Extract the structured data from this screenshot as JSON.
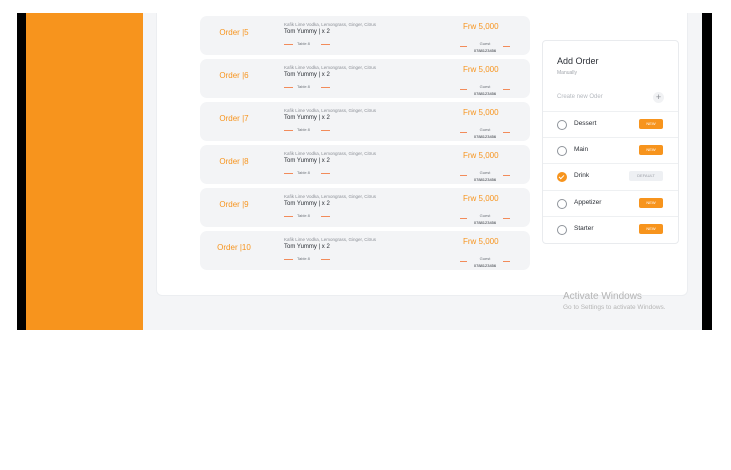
{
  "orders": [
    {
      "title": "Order |5",
      "desc": "Kafik Lime Vodka, Lemongrass, Ginger, Citrus",
      "item": "Tom Yummy  | x 2",
      "table": "Table 8",
      "price": "Frw 5,000",
      "guest": "Guest",
      "phone": "0788123456"
    },
    {
      "title": "Order |6",
      "desc": "Kafik Lime Vodka, Lemongrass, Ginger, Citrus",
      "item": "Tom Yummy  | x 2",
      "table": "Table 8",
      "price": "Frw 5,000",
      "guest": "Guest",
      "phone": "0788123456"
    },
    {
      "title": "Order |7",
      "desc": "Kafik Lime Vodka, Lemongrass, Ginger, Citrus",
      "item": "Tom Yummy  | x 2",
      "table": "Table 8",
      "price": "Frw 5,000",
      "guest": "Guest",
      "phone": "0788123456"
    },
    {
      "title": "Order |8",
      "desc": "Kafik Lime Vodka, Lemongrass, Ginger, Citrus",
      "item": "Tom Yummy  | x 2",
      "table": "Table 8",
      "price": "Frw 5,000",
      "guest": "Guest",
      "phone": "0788123456"
    },
    {
      "title": "Order |9",
      "desc": "Kafik Lime Vodka, Lemongrass, Ginger, Citrus",
      "item": "Tom Yummy  | x 2",
      "table": "Table 8",
      "price": "Frw 5,000",
      "guest": "Guest",
      "phone": "0788123456"
    },
    {
      "title": "Order |10",
      "desc": "Kafik Lime Vodka, Lemongrass, Ginger, Citrus",
      "item": "Tom Yummy  | x 2",
      "table": "Table 8",
      "price": "Frw 5,000",
      "guest": "Guest",
      "phone": "0788123456"
    }
  ],
  "add_order": {
    "title": "Add Order",
    "subtitle": "Manually",
    "create_placeholder": "Create new Oder",
    "plus_icon": "+",
    "categories": [
      {
        "label": "Dessert",
        "badge": "NEW",
        "checked": false
      },
      {
        "label": "Main",
        "badge": "NEW",
        "checked": false
      },
      {
        "label": "Drink",
        "badge": "DEFAULT",
        "checked": true
      },
      {
        "label": "Appetizer",
        "badge": "NEW",
        "checked": false
      },
      {
        "label": "Starter",
        "badge": "NEW",
        "checked": false
      }
    ]
  },
  "watermark": {
    "line1": "Activate Windows",
    "line2": "Go to Settings to activate Windows."
  },
  "colors": {
    "accent": "#f7941d",
    "badge_default_bg": "#eef0f3"
  }
}
